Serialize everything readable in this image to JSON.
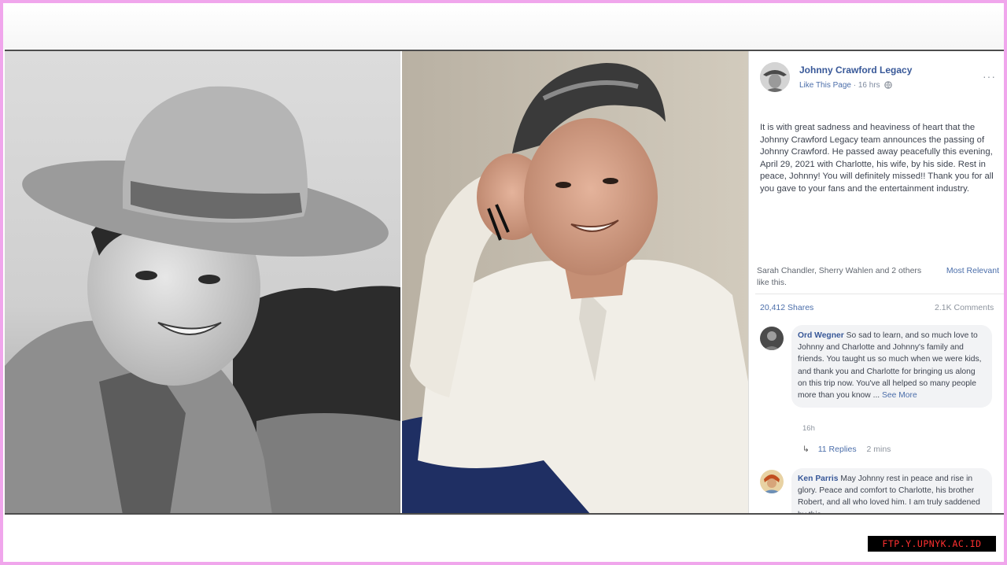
{
  "post": {
    "page_name": "Johnny Crawford Legacy",
    "like_page": "Like This Page",
    "time": "16 hrs",
    "more": "···",
    "text": "It is with great sadness and heaviness of heart that the Johnny Crawford Legacy team announces the passing of Johnny Crawford. He passed away peacefully this evening, April 29, 2021 with Charlotte, his wife, by his side. Rest in peace, Johnny! You will definitely missed!! Thank you for all you gave to your fans and the entertainment industry.",
    "reactions": "Sarah Chandler, Sherry Wahlen and 2 others like this.",
    "sort_label": "Most Relevant",
    "shares": "20,412 Shares",
    "comments_count": "2.1K Comments"
  },
  "comments": [
    {
      "author": "Ord Wegner",
      "text": "So sad to learn, and so much love to Johnny and Charlotte and Johnny's family and friends. You taught us so much when we were kids, and thank you and Charlotte for bringing us along on this trip now. You've all helped so many people more than you know ...",
      "see_more": "See More",
      "time": "16h",
      "replies": "11 Replies",
      "replies_time": "2 mins"
    },
    {
      "author": "Ken Parris",
      "text": "May Johnny rest in peace and rise in glory. Peace and comfort to Charlotte, his brother Robert, and all who loved him. I am truly saddened by this"
    }
  ],
  "watermark": "FTP.Y.UPNYK.AC.ID",
  "colors": {
    "border": "#f0a6ec",
    "link_blue": "#385898",
    "watermark_bg": "#000000",
    "watermark_text": "#ff3030"
  }
}
